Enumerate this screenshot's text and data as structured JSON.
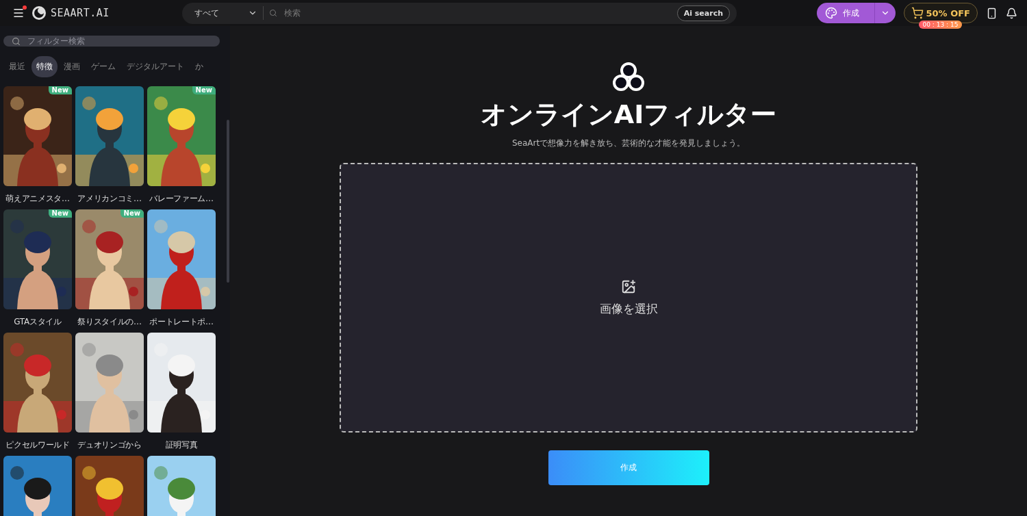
{
  "header": {
    "logo": "SEAART.AI",
    "menu_notification": true,
    "search": {
      "scope": "すべて",
      "placeholder": "検索",
      "ai_button": "Ai search"
    },
    "create_button": "作成",
    "promo": {
      "label": "50% OFF",
      "timer": "00 : 13 : 15"
    }
  },
  "sidebar": {
    "filter_search": {
      "placeholder": "フィルター検索"
    },
    "tabs": [
      {
        "label": "最近",
        "selected": false
      },
      {
        "label": "特徴",
        "selected": true
      },
      {
        "label": "漫画",
        "selected": false
      },
      {
        "label": "ゲーム",
        "selected": false
      },
      {
        "label": "デジタルアート",
        "selected": false
      },
      {
        "label": "か",
        "selected": false
      }
    ],
    "cards": [
      {
        "kind": "filter",
        "label": "萌えアニメスタ…",
        "badge": "New"
      },
      {
        "kind": "filter",
        "label": "アメリカンコミ…"
      },
      {
        "kind": "filter",
        "label": "バレーファーム…",
        "badge": "New"
      },
      {
        "kind": "filter",
        "label": "GTAスタイル",
        "badge": "New"
      },
      {
        "kind": "filter",
        "label": "祭りスタイルの…",
        "badge": "New"
      },
      {
        "kind": "filter",
        "label": "ポートレートポ…"
      },
      {
        "kind": "filter",
        "label": "ピクセルワールド"
      },
      {
        "kind": "filter",
        "label": "デュオリンゴから"
      },
      {
        "kind": "filter",
        "label": "証明写真"
      },
      {
        "kind": "picture"
      },
      {
        "kind": "picture"
      },
      {
        "kind": "picture"
      }
    ]
  },
  "main": {
    "title": "オンラインAIフィルター",
    "subtitle": "SeaArtで想像力を解き放ち、芸術的な才能を発見しましょう。",
    "upload_label": "画像を選択",
    "submit_button": "作成"
  }
}
